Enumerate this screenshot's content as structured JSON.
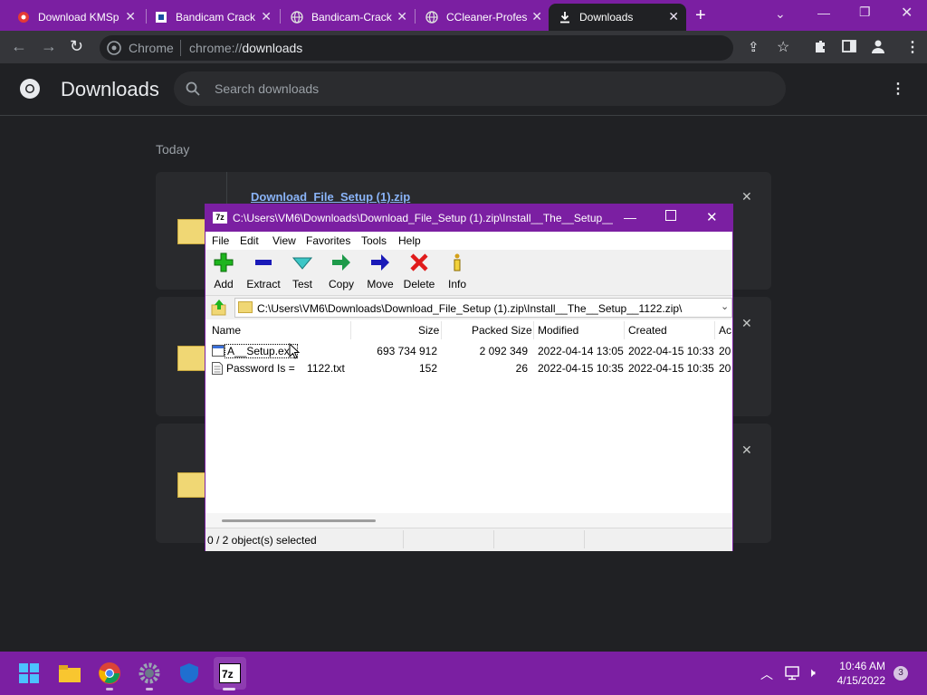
{
  "browser": {
    "tabs": [
      {
        "title": "Download KMSp",
        "icon": "red-circle-icon"
      },
      {
        "title": "Bandicam Crack",
        "icon": "bandicam-icon"
      },
      {
        "title": "Bandicam-Crack",
        "icon": "globe-icon"
      },
      {
        "title": "CCleaner-Profes",
        "icon": "globe-icon"
      },
      {
        "title": "Downloads",
        "icon": "download-icon"
      }
    ],
    "new_tab": "+",
    "omnibox_site": "Chrome",
    "omnibox_url_prefix": "chrome://",
    "omnibox_url_path": "downloads"
  },
  "downloads": {
    "title": "Downloads",
    "search_placeholder": "Search downloads",
    "section_label": "Today",
    "items": [
      {
        "name": "Download_File_Setup (1).zip"
      }
    ]
  },
  "sevenzip": {
    "title": "C:\\Users\\VM6\\Downloads\\Download_File_Setup (1).zip\\Install__The__Setup__...",
    "app_badge": "7z",
    "menu": [
      "File",
      "Edit",
      "View",
      "Favorites",
      "Tools",
      "Help"
    ],
    "toolbar": [
      {
        "label": "Add",
        "icon": "plus-icon",
        "color": "#1eb51e"
      },
      {
        "label": "Extract",
        "icon": "minus-icon",
        "color": "#1a1ab8"
      },
      {
        "label": "Test",
        "icon": "check-arrow-icon",
        "color": "#3cc6c6"
      },
      {
        "label": "Copy",
        "icon": "arrow-right-green-icon",
        "color": "#1e9a4a"
      },
      {
        "label": "Move",
        "icon": "arrow-right-blue-icon",
        "color": "#1a1ab8"
      },
      {
        "label": "Delete",
        "icon": "x-icon",
        "color": "#e01b1b"
      },
      {
        "label": "Info",
        "icon": "info-icon",
        "color": "#d4a017"
      }
    ],
    "address": "C:\\Users\\VM6\\Downloads\\Download_File_Setup (1).zip\\Install__The__Setup__1122.zip\\",
    "columns": [
      "Name",
      "Size",
      "Packed Size",
      "Modified",
      "Created",
      "Ac"
    ],
    "rows": [
      {
        "name": "A__Setup.exe",
        "size": "693 734 912",
        "packed": "2 092 349",
        "modified": "2022-04-14 13:05",
        "created": "2022-04-15 10:33",
        "ac": "20"
      },
      {
        "name": "Password Is =    1122.txt",
        "size": "152",
        "packed": "26",
        "modified": "2022-04-15 10:35",
        "created": "2022-04-15 10:35",
        "ac": "20"
      }
    ],
    "status": "0 / 2 object(s) selected"
  },
  "taskbar": {
    "time": "10:46 AM",
    "date": "4/15/2022",
    "notifications": "3"
  }
}
